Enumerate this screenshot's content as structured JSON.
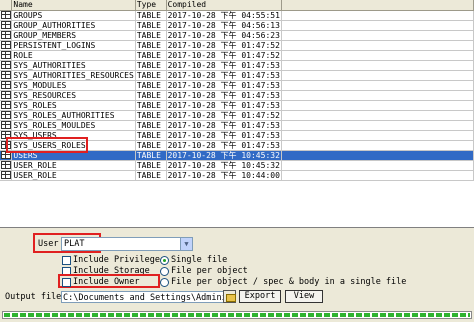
{
  "grid": {
    "columns": [
      "Name",
      "Type",
      "Compiled"
    ],
    "rows": [
      {
        "name": "GROUPS",
        "type": "TABLE",
        "compiled": "2017-10-28 下午 04:55:51"
      },
      {
        "name": "GROUP_AUTHORITIES",
        "type": "TABLE",
        "compiled": "2017-10-28 下午 04:56:13"
      },
      {
        "name": "GROUP_MEMBERS",
        "type": "TABLE",
        "compiled": "2017-10-28 下午 04:56:23"
      },
      {
        "name": "PERSISTENT_LOGINS",
        "type": "TABLE",
        "compiled": "2017-10-28 下午 01:47:52"
      },
      {
        "name": "ROLE",
        "type": "TABLE",
        "compiled": "2017-10-28 下午 01:47:52"
      },
      {
        "name": "SYS_AUTHORITIES",
        "type": "TABLE",
        "compiled": "2017-10-28 下午 01:47:53"
      },
      {
        "name": "SYS_AUTHORITIES_RESOURCES",
        "type": "TABLE",
        "compiled": "2017-10-28 下午 01:47:53"
      },
      {
        "name": "SYS_MODULES",
        "type": "TABLE",
        "compiled": "2017-10-28 下午 01:47:53"
      },
      {
        "name": "SYS_RESOURCES",
        "type": "TABLE",
        "compiled": "2017-10-28 下午 01:47:53"
      },
      {
        "name": "SYS_ROLES",
        "type": "TABLE",
        "compiled": "2017-10-28 下午 01:47:53"
      },
      {
        "name": "SYS_ROLES_AUTHORITIES",
        "type": "TABLE",
        "compiled": "2017-10-28 下午 01:47:52"
      },
      {
        "name": "SYS_ROLES_MOULDES",
        "type": "TABLE",
        "compiled": "2017-10-28 下午 01:47:53"
      },
      {
        "name": "SYS_USERS",
        "type": "TABLE",
        "compiled": "2017-10-28 下午 01:47:53"
      },
      {
        "name": "SYS_USERS_ROLES",
        "type": "TABLE",
        "compiled": "2017-10-28 下午 01:47:53"
      },
      {
        "name": "USERS",
        "type": "TABLE",
        "compiled": "2017-10-28 下午 10:45:32",
        "selected": true
      },
      {
        "name": "USER_ROLE",
        "type": "TABLE",
        "compiled": "2017-10-28 下午 10:45:32"
      },
      {
        "name": "USER_ROLE",
        "type": "TABLE",
        "compiled": "2017-10-28 下午 10:44:00"
      }
    ]
  },
  "options": {
    "user_label": "User",
    "user_value": "PLAT",
    "include_privileges": "Include Privileges",
    "include_storage": "Include Storage",
    "include_owner": "Include Owner",
    "single_file": "Single file",
    "file_per_object": "File per object",
    "file_per_object_spec_body": "File per object / spec & body in a single file"
  },
  "output": {
    "label": "Output file",
    "path": "C:\\Documents and Settings\\Admini",
    "export_label": "Export",
    "view_label": "View"
  },
  "progress": 1.0,
  "colors": {
    "selection": "#316AC5",
    "highlight_box": "#e02020",
    "progress": "#2fb32f"
  }
}
